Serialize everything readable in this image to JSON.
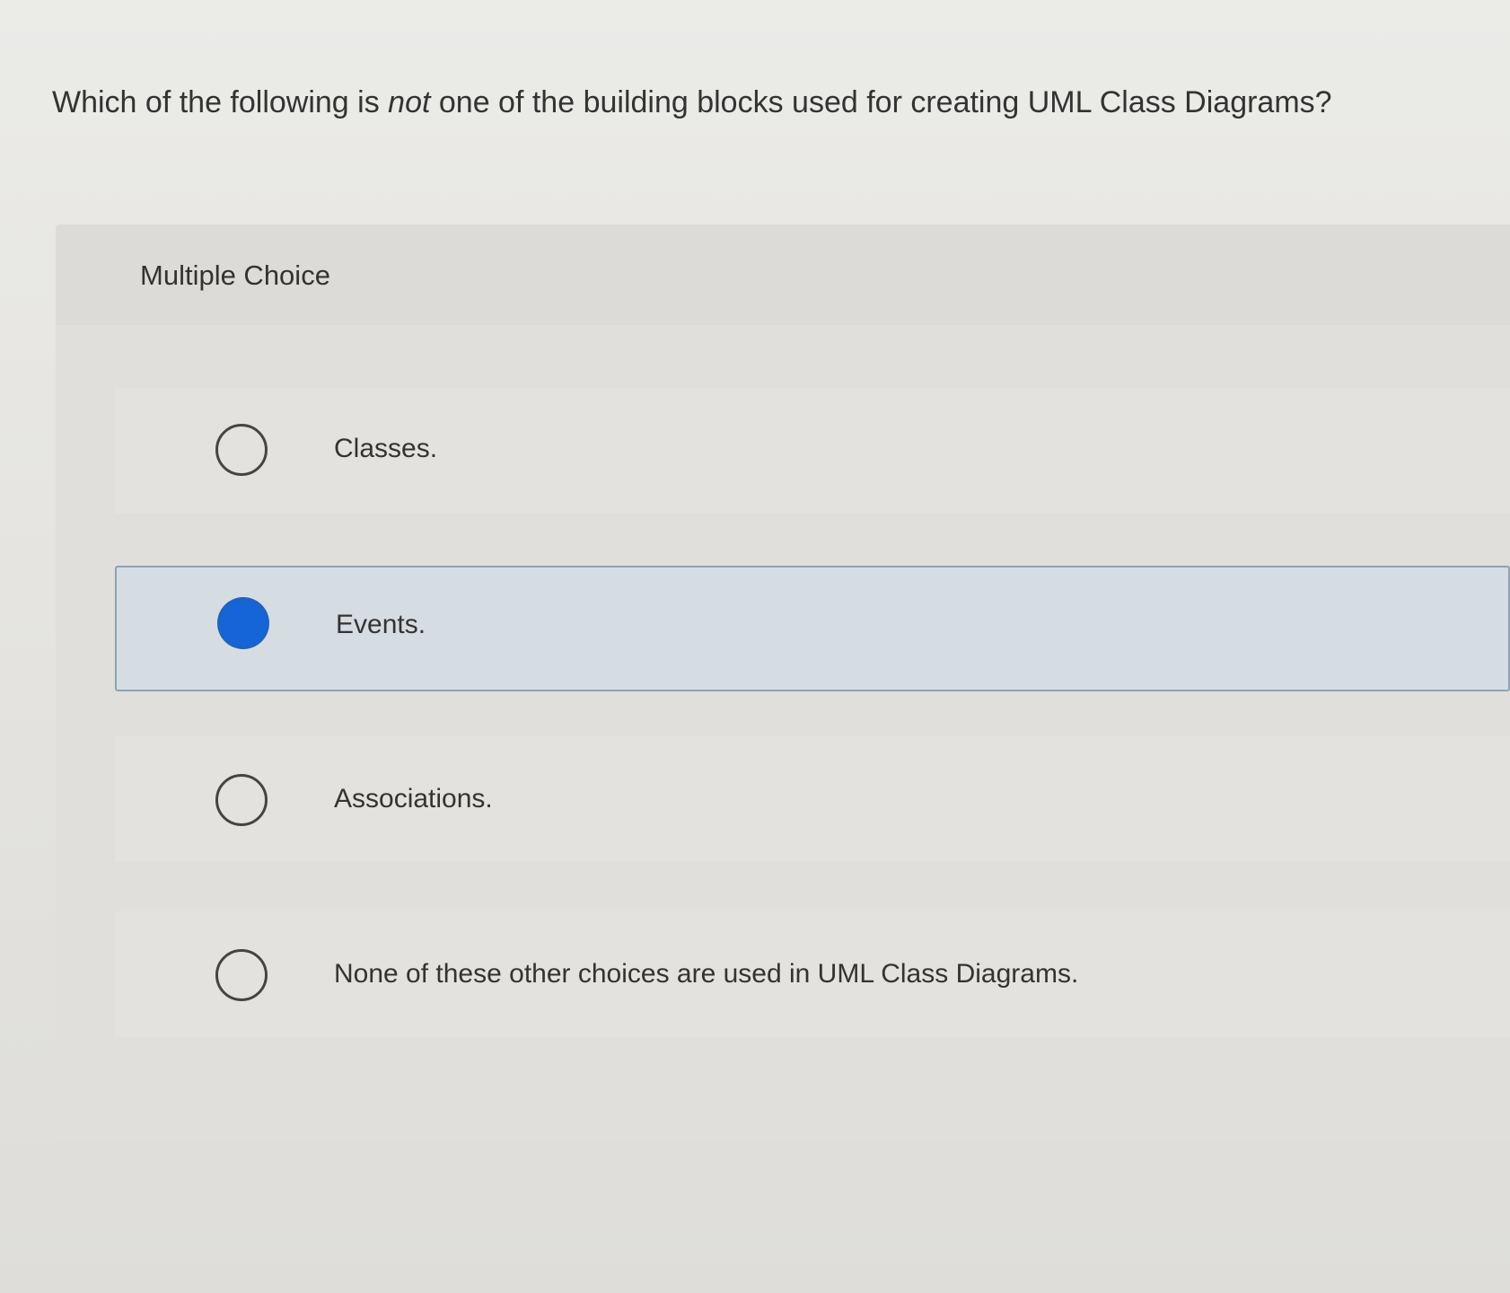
{
  "question": {
    "before": "Which of the following is ",
    "emphasis": "not",
    "after": " one of the building blocks used for creating UML Class Diagrams?"
  },
  "panel": {
    "label": "Multiple Choice"
  },
  "choices": [
    {
      "label": "Classes.",
      "selected": false
    },
    {
      "label": "Events.",
      "selected": true
    },
    {
      "label": "Associations.",
      "selected": false
    },
    {
      "label": "None of these other choices are used in UML Class Diagrams.",
      "selected": false
    }
  ],
  "colors": {
    "selected_fill": "#1565d8",
    "selected_row": "#d6dde2",
    "selected_border": "#8ea2b3"
  }
}
